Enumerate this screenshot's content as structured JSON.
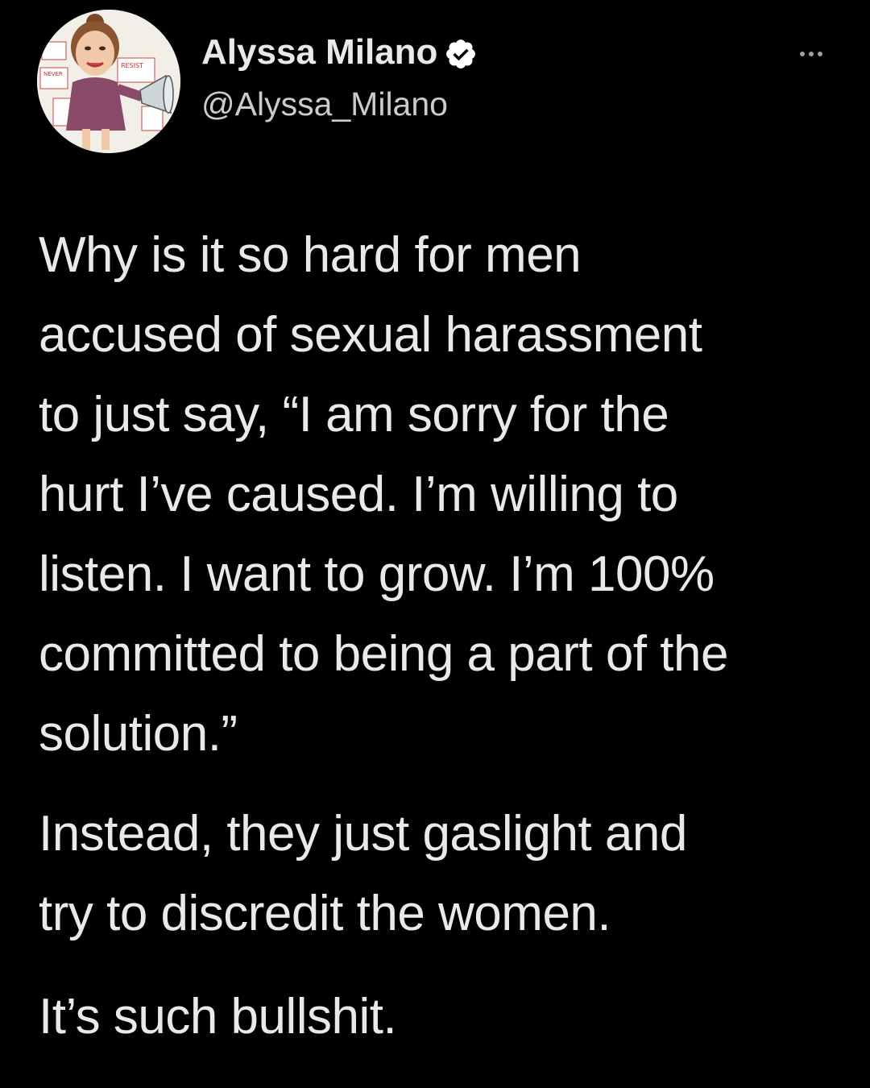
{
  "author": {
    "display_name": "Alyssa Milano",
    "handle": "@Alyssa_Milano",
    "avatar_sign_texts": [
      "RESIST",
      "NEVER"
    ]
  },
  "icons": {
    "verified": "verified-badge-icon",
    "more": "more-options-icon"
  },
  "colors": {
    "background": "#000000",
    "text": "#e7e9ea",
    "handle": "#c9cccf",
    "verified_badge": "#ffffff"
  },
  "tweet": {
    "paragraph1_lines": [
      "Why is it so hard for men",
      "accused of sexual harassment",
      "to just say, “I am sorry for the",
      "hurt I’ve caused. I’m willing to",
      "listen. I want to grow. I’m 100%",
      "committed to being a part of the",
      "solution.”"
    ],
    "paragraph2_lines": [
      "Instead, they just gaslight and",
      "try to discredit the women."
    ],
    "paragraph3_lines": [
      "It’s such bullshit."
    ]
  }
}
